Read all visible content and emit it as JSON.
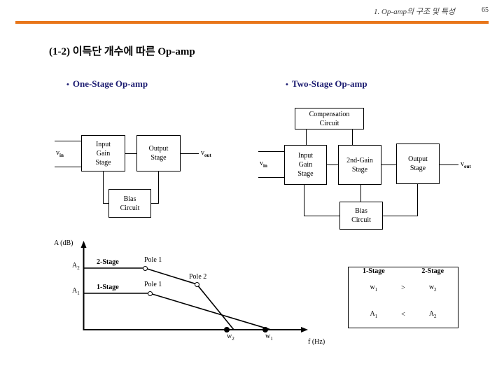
{
  "header": {
    "title": "1. Op-amp의 구조 및 특성",
    "page_number": "65",
    "rule_color": "#E8761A"
  },
  "slide": {
    "title": "(1-2) 이득단 개수에 따른 Op-amp",
    "bullet_color": "#1B1B70",
    "bullets": [
      {
        "dot": "•",
        "label": "One-Stage Op-amp"
      },
      {
        "dot": "•",
        "label": "Two-Stage Op-amp"
      }
    ]
  },
  "one_stage_diagram": {
    "input_label_html": "v",
    "input_label_sub": "in",
    "output_label_html": "v",
    "output_label_sub": "out",
    "boxes": {
      "input_gain": {
        "line1": "Input",
        "line2": "Gain",
        "line3": "Stage"
      },
      "output": {
        "line1": "Output",
        "line2": "Stage"
      },
      "bias": {
        "line1": "Bias",
        "line2": "Circuit"
      }
    }
  },
  "two_stage_diagram": {
    "input_label_html": "v",
    "input_label_sub": "in",
    "output_label_html": "v",
    "output_label_sub": "out",
    "boxes": {
      "compensation": {
        "line1": "Compensation",
        "line2": "Circuit"
      },
      "input_gain": {
        "line1": "Input",
        "line2": "Gain",
        "line3": "Stage"
      },
      "second_gain": {
        "line1": "2nd-Gain",
        "line2": "Stage"
      },
      "output": {
        "line1": "Output",
        "line2": "Stage"
      },
      "bias": {
        "line1": "Bias",
        "line2": "Circuit"
      }
    }
  },
  "chart_data": {
    "type": "line",
    "title": "",
    "ylabel": "A (dB)",
    "xlabel": "f (Hz)",
    "grid": false,
    "legend": "inline-annotations",
    "y_ticks": [
      {
        "label": "A",
        "sub": "1"
      },
      {
        "label": "A",
        "sub": "2"
      }
    ],
    "x_ticks": [
      {
        "label": "w",
        "sub": "2"
      },
      {
        "label": "w",
        "sub": "1"
      }
    ],
    "annotations": [
      {
        "text": "2-Stage",
        "bold": true
      },
      {
        "text": "1-Stage",
        "bold": true
      },
      {
        "text": "Pole 1"
      },
      {
        "text": "Pole 1"
      },
      {
        "text": "Pole 2"
      }
    ],
    "series": [
      {
        "name": "2-Stage",
        "points": [
          {
            "x": 0,
            "y": 110,
            "label": "A2 flat start"
          },
          {
            "x": 138,
            "y": 110,
            "label": "Pole 1"
          },
          {
            "x": 280,
            "y": 75,
            "label": "Pole 2"
          },
          {
            "x": 334,
            "y": 0,
            "label": "w2"
          }
        ]
      },
      {
        "name": "1-Stage",
        "points": [
          {
            "x": 0,
            "y": 73,
            "label": "A1 flat start"
          },
          {
            "x": 145,
            "y": 73,
            "label": "Pole 1"
          },
          {
            "x": 387,
            "y": 0,
            "label": "w1"
          }
        ]
      }
    ]
  },
  "comparison_table": {
    "headers": [
      "1-Stage",
      "2-Stage"
    ],
    "rows": [
      {
        "left": "w",
        "left_sub": "1",
        "op": ">",
        "right": "w",
        "right_sub": "2"
      },
      {
        "left": "A",
        "left_sub": "1",
        "op": "<",
        "right": "A",
        "right_sub": "2"
      }
    ]
  }
}
